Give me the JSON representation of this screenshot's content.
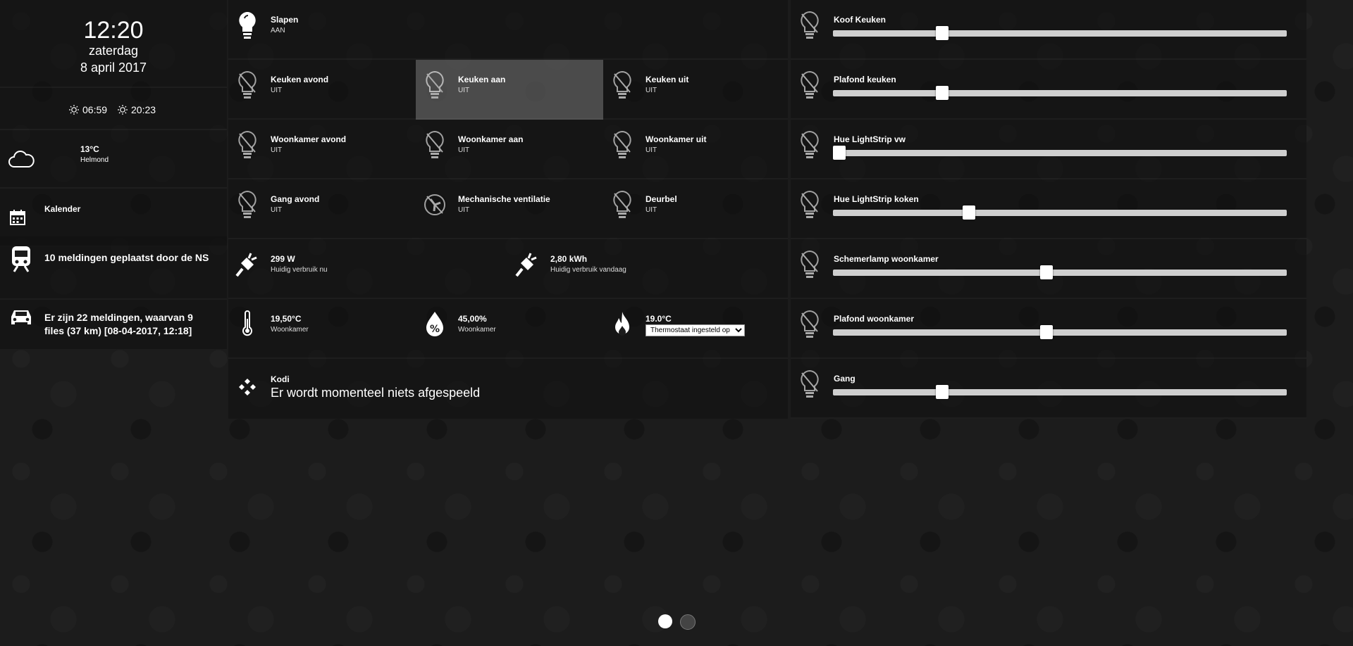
{
  "sidebar": {
    "time": "12:20",
    "day": "zaterdag",
    "date": "8 april 2017",
    "sunrise": "06:59",
    "sunset": "20:23",
    "weather": {
      "temp": "13°C",
      "location": "Helmond",
      "icon": "cloud-icon"
    },
    "calendar": {
      "label": "Kalender",
      "icon": "calendar-icon"
    },
    "ns": {
      "label": "10 meldingen geplaatst door de NS",
      "icon": "train-icon"
    },
    "traffic": {
      "label": "Er zijn 22 meldingen, waarvan 9 files (37 km) [08-04-2017, 12:18]",
      "icon": "car-icon"
    }
  },
  "switches": [
    {
      "title": "Slapen",
      "status": "AAN",
      "icon": "bulb-on-icon"
    },
    {
      "title": "Keuken avond",
      "status": "UIT",
      "icon": "bulb-off-icon"
    },
    {
      "title": "Keuken aan",
      "status": "UIT",
      "icon": "bulb-off-icon"
    },
    {
      "title": "Keuken uit",
      "status": "UIT",
      "icon": "bulb-off-icon"
    },
    {
      "title": "Woonkamer avond",
      "status": "UIT",
      "icon": "bulb-off-icon"
    },
    {
      "title": "Woonkamer aan",
      "status": "UIT",
      "icon": "bulb-off-icon"
    },
    {
      "title": "Woonkamer uit",
      "status": "UIT",
      "icon": "bulb-off-icon"
    },
    {
      "title": "Gang avond",
      "status": "UIT",
      "icon": "bulb-off-icon"
    },
    {
      "title": "Mechanische ventilatie",
      "status": "UIT",
      "icon": "fan-off-icon"
    },
    {
      "title": "Deurbel",
      "status": "UIT",
      "icon": "bulb-off-icon"
    }
  ],
  "energy": [
    {
      "value": "299 W",
      "label": "Huidig verbruik nu",
      "icon": "plug-icon"
    },
    {
      "value": "2,80 kWh",
      "label": "Huidig verbruik vandaag",
      "icon": "plug-icon"
    }
  ],
  "climate": {
    "temperature": {
      "value": "19,50°C",
      "label": "Woonkamer",
      "icon": "thermometer-icon"
    },
    "humidity": {
      "value": "45,00%",
      "label": "Woonkamer",
      "icon": "humidity-icon"
    },
    "thermostat": {
      "value": "19.0°C",
      "selected": "Thermostaat ingesteld op",
      "icon": "flame-icon"
    }
  },
  "kodi": {
    "title": "Kodi",
    "status": "Er wordt momenteel niets afgespeeld",
    "icon": "kodi-icon"
  },
  "dimmers": [
    {
      "title": "Koof Keuken",
      "level": 0.24,
      "icon": "bulb-off-icon"
    },
    {
      "title": "Plafond keuken",
      "level": 0.24,
      "icon": "bulb-off-icon"
    },
    {
      "title": "Hue LightStrip vw",
      "level": 0.0,
      "icon": "bulb-off-icon"
    },
    {
      "title": "Hue LightStrip koken",
      "level": 0.3,
      "icon": "bulb-off-icon"
    },
    {
      "title": "Schemerlamp woonkamer",
      "level": 0.47,
      "icon": "bulb-off-icon"
    },
    {
      "title": "Plafond woonkamer",
      "level": 0.47,
      "icon": "bulb-off-icon"
    },
    {
      "title": "Gang",
      "level": 0.24,
      "icon": "bulb-off-icon"
    }
  ],
  "pager": {
    "pages": 2,
    "current": 0
  },
  "colors": {
    "active_tile": "#5f5f5f",
    "text": "#ffffff",
    "slider_track": "#cfcfcf"
  }
}
